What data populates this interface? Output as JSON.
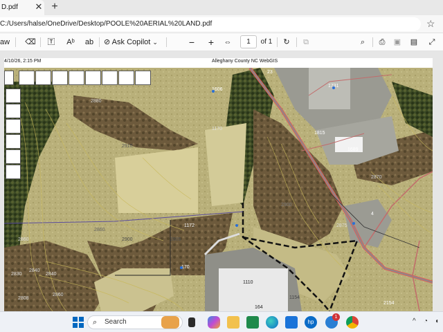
{
  "tab": {
    "title": "D.pdf",
    "close": "✕",
    "new_tab": "+"
  },
  "address": {
    "url": "C:/Users/halse/OneDrive/Desktop/POOLE%20AERIAL%20LAND.pdf",
    "favorite_icon": "star-icon"
  },
  "toolbar": {
    "draw_label": "aw",
    "ask_copilot_label": "Ask Copilot",
    "zoom_out": "−",
    "zoom_in": "+",
    "page_value": "1",
    "page_count": "of 1",
    "icons": [
      "eraser-icon",
      "text-icon",
      "read-aloud-icon",
      "translate-icon",
      "copilot-icon",
      "fit-page-icon",
      "rotate-icon",
      "two-page-icon",
      "search-icon",
      "print-icon",
      "save-icon",
      "save-as-icon",
      "expand-icon"
    ]
  },
  "document": {
    "header_date": "4/10/26, 2:15 PM",
    "header_title": "Alleghany County NC WebGIS",
    "map_labels": [
      "1606",
      "1731",
      "1815",
      "1689",
      "2900",
      "2880",
      "2910",
      "2900",
      "2860",
      "2840",
      "2840",
      "2830",
      "2860",
      "2870",
      "1172",
      "170",
      "1110",
      "164",
      "1154",
      "1170",
      "2154",
      "2875",
      "2805",
      "2808",
      "2860",
      "23",
      "4"
    ]
  },
  "taskbar": {
    "search_placeholder": "Search",
    "apps": [
      "windows-start-icon",
      "search-icon",
      "fox-widget-icon",
      "task-view-icon",
      "copilot-app-icon",
      "file-explorer-icon",
      "excel-icon",
      "edge-icon",
      "store-icon",
      "hp-icon",
      "mail-icon",
      "chrome-icon"
    ],
    "notification_badge": "1",
    "tray_chevron": "^"
  },
  "colors": {
    "road": "#e05a5a",
    "parcel_line": "#111111",
    "contour": "#c8b85a",
    "accent": "#0067c0"
  }
}
